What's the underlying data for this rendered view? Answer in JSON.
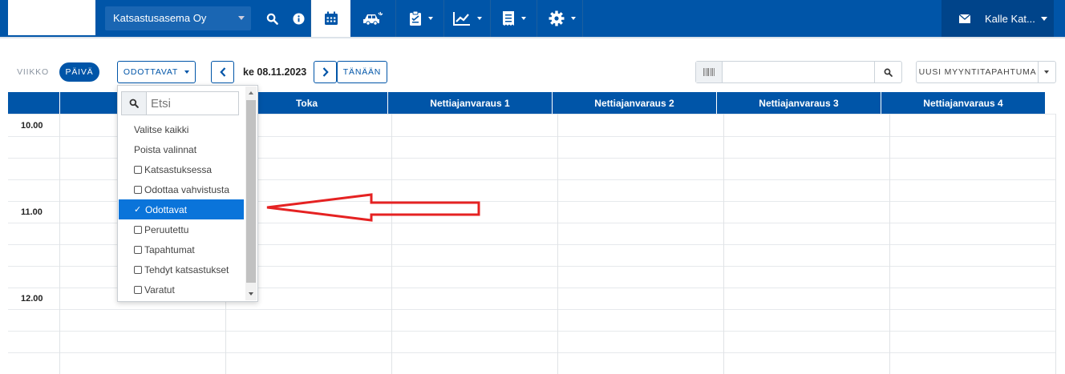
{
  "nav": {
    "company": "Katsastusasema Oy",
    "user": "Kalle Kat...",
    "icons": [
      "search-icon",
      "info-icon",
      "calendar-icon",
      "car-icon",
      "clipboard-icon",
      "chart-icon",
      "receipt-icon",
      "gear-icon",
      "envelope-icon"
    ]
  },
  "toolbar": {
    "week_label": "VIIKKO",
    "day_label": "PÄIVÄ",
    "filter_label": "ODOTTAVAT",
    "date": "ke 08.11.2023",
    "today_label": "TÄNÄÄN",
    "new_sale_label": "UUSI MYYNTITAPAHTUMA"
  },
  "calendar": {
    "columns": [
      "",
      "Toka",
      "Nettiajanvaraus 1",
      "Nettiajanvaraus 2",
      "Nettiajanvaraus 3",
      "Nettiajanvaraus 4"
    ],
    "times": [
      "10.00",
      "11.00",
      "12.00"
    ]
  },
  "dropdown": {
    "search_placeholder": "Etsi",
    "select_all": "Valitse kaikki",
    "clear_all": "Poista valinnat",
    "options": [
      {
        "label": "Katsastuksessa",
        "checked": false
      },
      {
        "label": "Odottaa vahvistusta",
        "checked": false
      },
      {
        "label": "Odottavat",
        "checked": true
      },
      {
        "label": "Peruutettu",
        "checked": false
      },
      {
        "label": "Tapahtumat",
        "checked": false
      },
      {
        "label": "Tehdyt katsastukset",
        "checked": false
      },
      {
        "label": "Varatut",
        "checked": false
      }
    ]
  },
  "colors": {
    "primary": "#0055a8",
    "selected": "#0a74da",
    "annotation": "#e52222"
  }
}
